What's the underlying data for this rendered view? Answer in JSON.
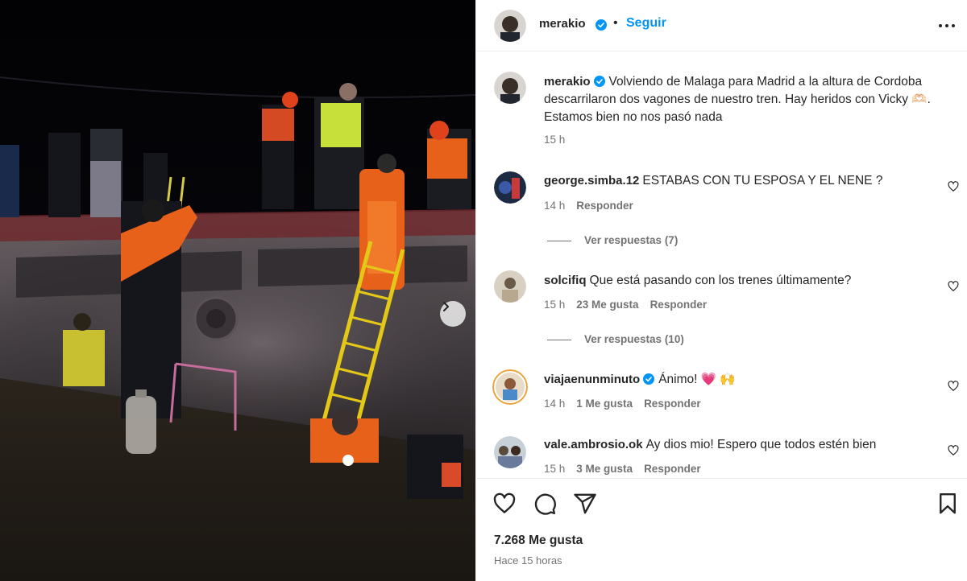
{
  "post": {
    "username": "merakio",
    "follow_label": "Seguir",
    "separator": "•",
    "caption": "Volviendo de Malaga para Madrid a la altura de Cordoba descarrilaron dos vagones de nuestro tren. Hay heridos con Vicky 🫶🏻. Estamos bien no nos pasó nada",
    "caption_time": "15 h"
  },
  "comments": [
    {
      "username": "george.simba.12",
      "text": "ESTABAS CON TU ESPOSA Y EL NENE ?",
      "time": "14 h",
      "likes": "",
      "reply_label": "Responder",
      "view_replies": "Ver respuestas (7)",
      "verified": false
    },
    {
      "username": "solcifiq",
      "text": "Que está pasando con los trenes últimamente?",
      "time": "15 h",
      "likes": "23 Me gusta",
      "reply_label": "Responder",
      "view_replies": "Ver respuestas (10)",
      "verified": false
    },
    {
      "username": "viajaenunminuto",
      "text": "Ánimo! 💗 🙌",
      "time": "14 h",
      "likes": "1 Me gusta",
      "reply_label": "Responder",
      "view_replies": "",
      "verified": true
    },
    {
      "username": "vale.ambrosio.ok",
      "text": "Ay dios mio! Espero que todos estén bien",
      "time": "15 h",
      "likes": "3 Me gusta",
      "reply_label": "Responder",
      "view_replies": "",
      "verified": false
    }
  ],
  "footer": {
    "likes_count": "7.268 Me gusta",
    "posted_ago": "Hace 15 horas"
  },
  "icons": {
    "verified": "verified-badge-icon",
    "more": "more-options-icon",
    "like": "heart-icon",
    "comment": "comment-icon",
    "share": "share-icon",
    "save": "bookmark-icon",
    "next": "chevron-right-icon"
  },
  "colors": {
    "accent": "#0095f6",
    "text": "#262626",
    "secondary": "#737373",
    "vest_orange": "#e8611a",
    "vest_yellow": "#c8e03a"
  }
}
